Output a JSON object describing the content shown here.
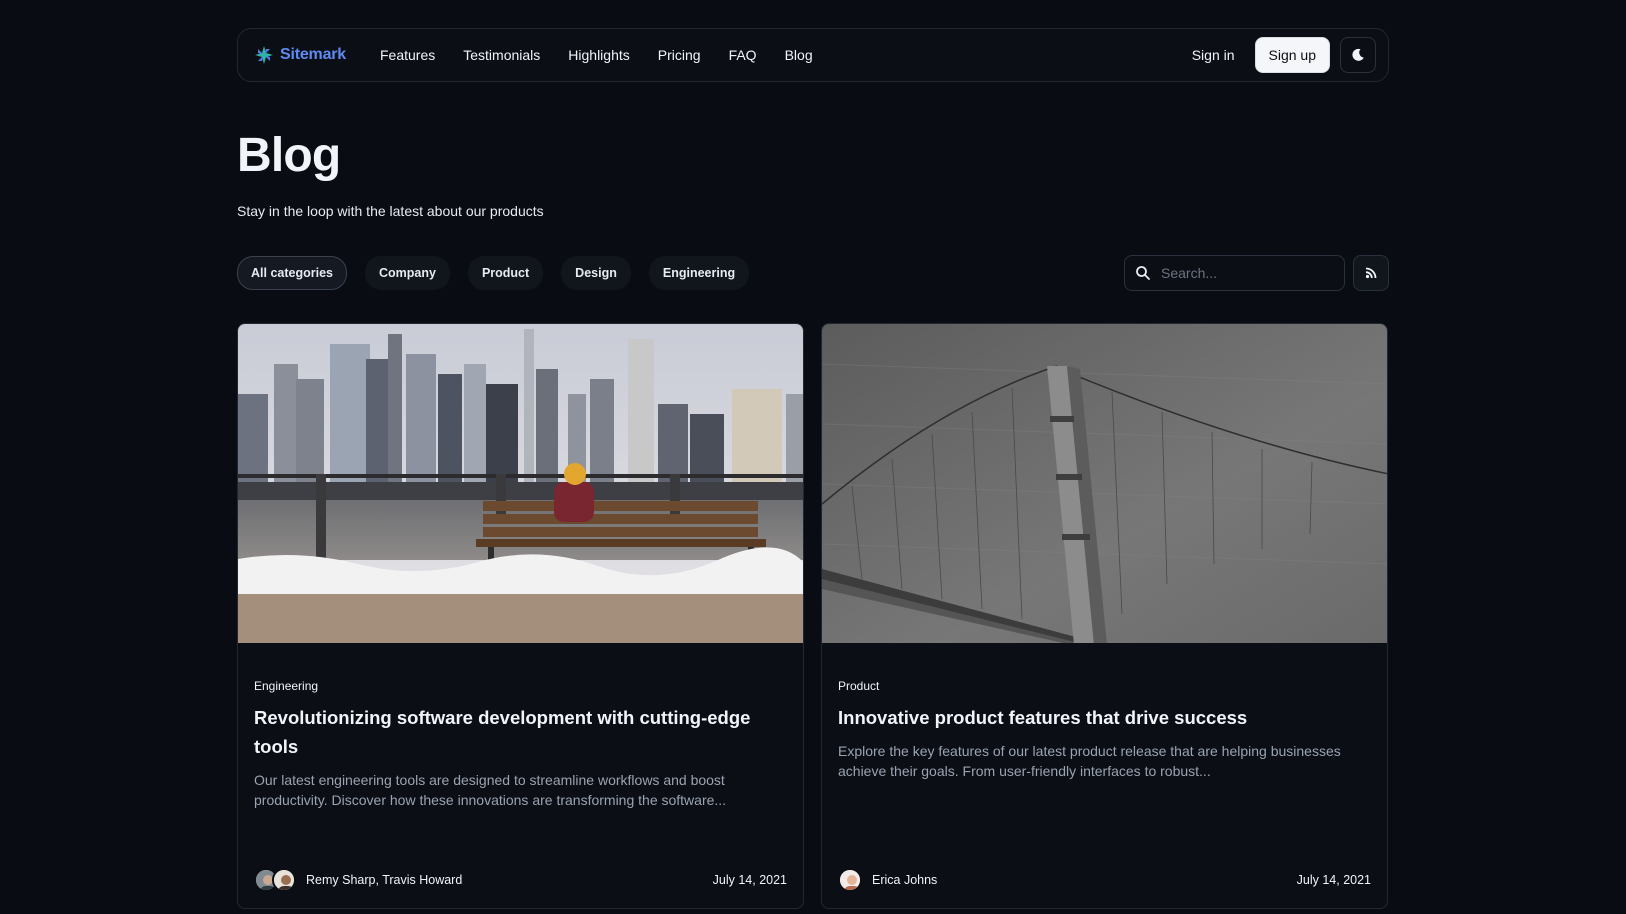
{
  "nav": {
    "brand": "Sitemark",
    "links": [
      "Features",
      "Testimonials",
      "Highlights",
      "Pricing",
      "FAQ",
      "Blog"
    ],
    "signin": "Sign in",
    "signup": "Sign up"
  },
  "page": {
    "title": "Blog",
    "subtitle": "Stay in the loop with the latest about our products"
  },
  "filters": {
    "categories": [
      "All categories",
      "Company",
      "Product",
      "Design",
      "Engineering"
    ],
    "active_category": "All categories",
    "search_placeholder": "Search..."
  },
  "posts": [
    {
      "tag": "Engineering",
      "title": "Revolutionizing software development with cutting-edge tools",
      "excerpt": "Our latest engineering tools are designed to streamline workflows and boost productivity. Discover how these innovations are transforming the software...",
      "authors": "Remy Sharp, Travis Howard",
      "date": "July 14, 2021"
    },
    {
      "tag": "Product",
      "title": "Innovative product features that drive success",
      "excerpt": "Explore the key features of our latest product release that are helping businesses achieve their goals. From user-friendly interfaces to robust...",
      "authors": "Erica Johns",
      "date": "July 14, 2021"
    }
  ],
  "colors": {
    "background": "#090c12",
    "brand": "#5e8bf2",
    "border": "#222833",
    "muted_text": "#9aa3b1"
  },
  "icons": [
    "sitemark-logo-icon",
    "moon-icon",
    "search-icon",
    "rss-icon"
  ]
}
